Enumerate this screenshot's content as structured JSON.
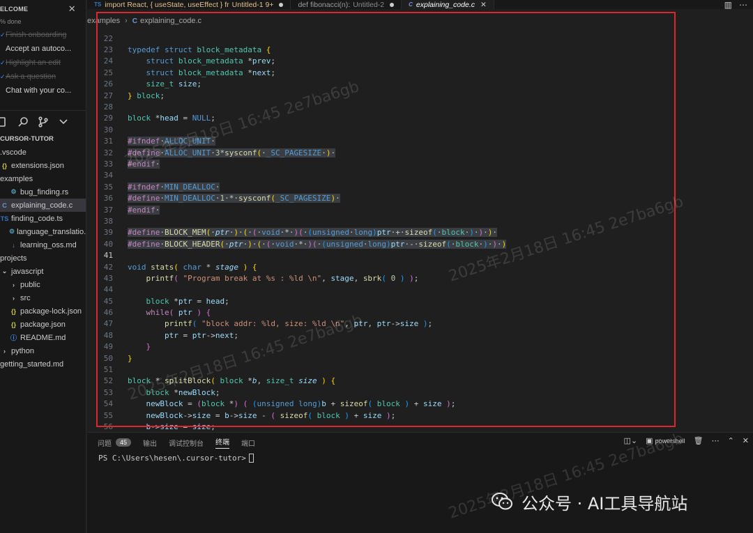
{
  "welcome": {
    "title": "ELCOME",
    "progress": "% done",
    "items": [
      {
        "label": "Finish onboarding",
        "done": true
      },
      {
        "label": "Accept an autoco...",
        "done": false
      },
      {
        "label": "Highlight an edit",
        "done": true
      },
      {
        "label": "Ask a question",
        "done": true
      },
      {
        "label": "Chat with your co...",
        "done": false
      }
    ]
  },
  "explorer": {
    "title": "CURSOR-TUTOR",
    "items": [
      {
        "label": ".vscode",
        "icon": "",
        "indent": 0
      },
      {
        "label": "extensions.json",
        "icon": "{}",
        "kind": "json",
        "indent": 0
      },
      {
        "label": "examples",
        "icon": "",
        "indent": 0
      },
      {
        "label": "bug_finding.rs",
        "icon": "⚙",
        "kind": "rs",
        "indent": 1
      },
      {
        "label": "explaining_code.c",
        "icon": "C",
        "kind": "c",
        "indent": 0,
        "selected": true
      },
      {
        "label": "finding_code.ts",
        "icon": "TS",
        "kind": "ts",
        "indent": 0
      },
      {
        "label": "language_translatio...",
        "icon": "⚙",
        "kind": "rs",
        "indent": 1
      },
      {
        "label": "learning_oss.md",
        "icon": "↓",
        "kind": "md",
        "indent": 1
      },
      {
        "label": "projects",
        "icon": "",
        "indent": 0
      },
      {
        "label": "javascript",
        "icon": "⌄",
        "indent": 0
      },
      {
        "label": "public",
        "icon": "›",
        "indent": 1
      },
      {
        "label": "src",
        "icon": "›",
        "indent": 1
      },
      {
        "label": "package-lock.json",
        "icon": "{}",
        "kind": "json",
        "indent": 1
      },
      {
        "label": "package.json",
        "icon": "{}",
        "kind": "json",
        "indent": 1
      },
      {
        "label": "README.md",
        "icon": "ⓘ",
        "kind": "info",
        "indent": 1
      },
      {
        "label": "python",
        "icon": "›",
        "indent": 0
      },
      {
        "label": "getting_started.md",
        "icon": "",
        "indent": 0
      }
    ]
  },
  "tabs": [
    {
      "prefix": "TS",
      "label": "import React, { useState, useEffect } fr",
      "suffix": "Untitled-1 9+",
      "dirty": true
    },
    {
      "prefix": "",
      "label": "def fibonacci(n):",
      "suffix": "Untitled-2",
      "dirty": true
    },
    {
      "prefix": "C",
      "label": "explaining_code.c",
      "suffix": "",
      "active": true
    }
  ],
  "breadcrumb": {
    "folder": "examples",
    "file": "explaining_code.c"
  },
  "code": [
    {
      "n": "22",
      "html": ""
    },
    {
      "n": "23",
      "html": "<span class='kw'>typedef</span> <span class='kw'>struct</span> <span class='ty'>block_metadata</span> <span class='br1'>{</span>"
    },
    {
      "n": "24",
      "html": "  <span class='kw'>struct</span> <span class='ty'>block_metadata</span> *<span class='id'>prev</span>;"
    },
    {
      "n": "25",
      "html": "  <span class='kw'>struct</span> <span class='ty'>block_metadata</span> *<span class='id'>next</span>;"
    },
    {
      "n": "26",
      "html": "  <span class='ty'>size_t</span> <span class='id'>size</span>;"
    },
    {
      "n": "27",
      "html": "<span class='br1'>}</span> <span class='ty'>block</span>;"
    },
    {
      "n": "28",
      "html": ""
    },
    {
      "n": "29",
      "html": "<span class='ty'>block</span> *<span class='id'>head</span> = <span class='kw'>NULL</span>;"
    },
    {
      "n": "30",
      "html": ""
    },
    {
      "n": "31",
      "html": "<span class='hlbg'><span class='pp'>#ifndef</span>·<span class='kw'>ALLOC_UNIT</span>·</span>",
      "hl": true
    },
    {
      "n": "32",
      "html": "<span class='hlbg'><span class='pp'>#define</span>·<span class='kw'>ALLOC_UNIT</span>·<span class='nu'>3</span>*<span class='fn'>sysconf</span><span class='br1'>(</span>·<span class='kw'>_SC_PAGESIZE</span>·<span class='br1'>)</span>·</span>",
      "hl": true
    },
    {
      "n": "33",
      "html": "<span class='hlbg'><span class='pp'>#endif</span>·</span>",
      "hl": true
    },
    {
      "n": "34",
      "html": ""
    },
    {
      "n": "35",
      "html": "<span class='hlbg'><span class='pp'>#ifndef</span>·<span class='kw'>MIN_DEALLOC</span>·</span>",
      "hl": true
    },
    {
      "n": "36",
      "html": "<span class='hlbg'><span class='pp'>#define</span>·<span class='kw'>MIN_DEALLOC</span>·<span class='nu'>1</span>·*·<span class='fn'>sysconf</span><span class='br1'>(</span><span class='kw'>_SC_PAGESIZE</span><span class='br1'>)</span>·</span>",
      "hl": true
    },
    {
      "n": "37",
      "html": "<span class='hlbg'><span class='pp'>#endif</span>·</span>",
      "hl": true
    },
    {
      "n": "38",
      "html": ""
    },
    {
      "n": "39",
      "html": "<span class='hlbg'><span class='pp'>#define</span>·<span class='fn'>BLOCK_MEM</span><span class='br1'>(</span>·<span class='it'>ptr</span>·<span class='br1'>)</span>·<span class='br1'>(</span>·<span class='br2'>(</span>·<span class='kw'>void</span>·*·<span class='br2'>)</span><span class='br2'>(</span>·<span class='br3'>(</span><span class='kw'>unsigned</span>·<span class='kw'>long</span><span class='br3'>)</span><span class='id'>ptr</span>·+·<span class='fn'>sizeof</span><span class='br3'>(</span>·<span class='ty'>block</span>·<span class='br3'>)</span>·<span class='br2'>)</span>·<span class='br1'>)</span>·</span>",
      "hl": true
    },
    {
      "n": "40",
      "html": "<span class='hlbg'><span class='pp'>#define</span>·<span class='fn'>BLOCK_HEADER</span><span class='br1'>(</span>·<span class='it'>ptr</span>·<span class='br1'>)</span>·<span class='br1'>(</span>·<span class='br2'>(</span>·<span class='kw'>void</span>·*·<span class='br2'>)</span><span class='br2'>(</span>·<span class='br3'>(</span><span class='kw'>unsigned</span>·<span class='kw'>long</span><span class='br3'>)</span><span class='id'>ptr</span>·-·<span class='fn'>sizeof</span><span class='br3'>(</span>·<span class='ty'>block</span>·<span class='br3'>)</span>·<span class='br2'>)</span>·<span class='br1'>)</span></span>",
      "hl": true
    },
    {
      "n": "41",
      "html": "",
      "cur": true
    },
    {
      "n": "42",
      "html": "<span class='kw'>void</span> <span class='fn'>stats</span><span class='br1'>(</span> <span class='kw'>char</span> * <span class='it'>stage</span> <span class='br1'>)</span> <span class='br1'>{</span>"
    },
    {
      "n": "43",
      "html": "  <span class='fn'>printf</span><span class='br2'>(</span> <span class='st'>\"Program break at %s : %ld \\n\"</span>, <span class='id'>stage</span>, <span class='fn'>sbrk</span><span class='br3'>(</span> <span class='nu'>0</span> <span class='br3'>)</span> <span class='br2'>)</span>;"
    },
    {
      "n": "44",
      "html": ""
    },
    {
      "n": "45",
      "html": "  <span class='ty'>block</span> *<span class='id'>ptr</span> = <span class='id'>head</span>;"
    },
    {
      "n": "46",
      "html": "  <span class='pp'>while</span><span class='br2'>(</span> <span class='id'>ptr</span> <span class='br2'>)</span> <span class='br2'>{</span>"
    },
    {
      "n": "47",
      "html": "    <span class='fn'>printf</span><span class='br3'>(</span> <span class='st'>\"block addr: %ld, size: %ld \\n\"</span>, <span class='id'>ptr</span>, <span class='id'>ptr</span>-><span class='id'>size</span> <span class='br3'>)</span>;"
    },
    {
      "n": "48",
      "html": "    <span class='id'>ptr</span> = <span class='id'>ptr</span>-><span class='id'>next</span>;"
    },
    {
      "n": "49",
      "html": "  <span class='br2'>}</span>"
    },
    {
      "n": "50",
      "html": "<span class='br1'>}</span>"
    },
    {
      "n": "51",
      "html": ""
    },
    {
      "n": "52",
      "html": "<span class='ty'>block</span> * <span class='fn'>splitBlock</span><span class='br1'>(</span> <span class='ty'>block</span> *<span class='it'>b</span>, <span class='ty'>size_t</span> <span class='it'>size</span> <span class='br1'>)</span> <span class='br1'>{</span>"
    },
    {
      "n": "53",
      "html": "  <span class='ty'>block</span> *<span class='id'>newBlock</span>;"
    },
    {
      "n": "54",
      "html": "  <span class='id'>newBlock</span> = <span class='br2'>(</span><span class='ty'>block</span> *<span class='br2'>)</span> <span class='br2'>(</span> <span class='br3'>(</span><span class='kw'>unsigned</span> <span class='kw'>long</span><span class='br3'>)</span><span class='id'>b</span> + <span class='fn'>sizeof</span><span class='br3'>(</span> <span class='ty'>block</span> <span class='br3'>)</span> + <span class='id'>size</span> <span class='br2'>)</span>;"
    },
    {
      "n": "55",
      "html": "  <span class='id'>newBlock</span>-><span class='id'>size</span> = <span class='id'>b</span>-><span class='id'>size</span> - <span class='br2'>(</span> <span class='fn'>sizeof</span><span class='br3'>(</span> <span class='ty'>block</span> <span class='br3'>)</span> + <span class='id'>size</span> <span class='br2'>)</span>;"
    },
    {
      "n": "56",
      "html": "  <span class='id'>b</span>-><span class='id'>size</span> = <span class='id'>size</span>;"
    }
  ],
  "panel": {
    "tabs": [
      {
        "label": "问题",
        "badge": "45"
      },
      {
        "label": "输出"
      },
      {
        "label": "调试控制台"
      },
      {
        "label": "终端",
        "active": true
      },
      {
        "label": "端口"
      }
    ],
    "shell": "powershell",
    "prompt": "PS C:\\Users\\hesen\\.cursor-tutor>"
  },
  "watermark": {
    "text": "2025年2月18日 16:45 2e7ba6gb",
    "brand": "公众号 · AI工具导航站"
  },
  "colors": {
    "accent": "#3794ff",
    "highlight_box": "#e0262d"
  }
}
